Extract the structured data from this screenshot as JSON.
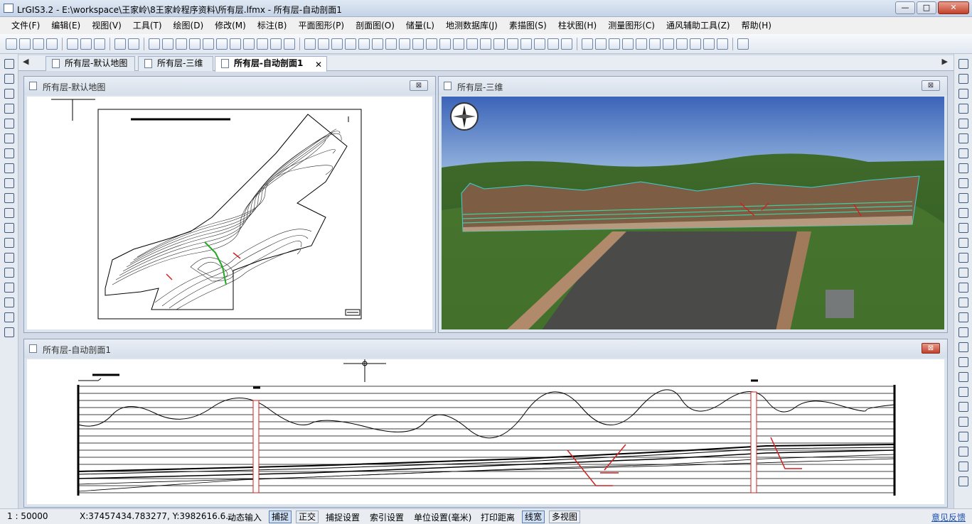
{
  "window": {
    "title": "LrGIS3.2 - E:\\workspace\\王家岭\\8王家岭程序资料\\所有层.lfmx - 所有层-自动剖面1",
    "minimize": "—",
    "maximize": "□",
    "close": "✕"
  },
  "menu": [
    "文件(F)",
    "编辑(E)",
    "视图(V)",
    "工具(T)",
    "绘图(D)",
    "修改(M)",
    "标注(B)",
    "平面图形(P)",
    "剖面图(O)",
    "储量(L)",
    "地测数据库(J)",
    "素描图(S)",
    "柱状图(H)",
    "测量图形(C)",
    "通风辅助工具(Z)",
    "帮助(H)"
  ],
  "tabs": [
    {
      "label": "所有层-默认地图",
      "active": false
    },
    {
      "label": "所有层-三维",
      "active": false
    },
    {
      "label": "所有层-自动剖面1",
      "active": true
    }
  ],
  "tab_close": "✕",
  "tab_nav": {
    "left": "◀",
    "right": "▶"
  },
  "panes": {
    "map": {
      "title": "所有层-默认地图",
      "close": "⊠"
    },
    "threed": {
      "title": "所有层-三维",
      "close": "⊠"
    },
    "profile": {
      "title": "所有层-自动剖面1",
      "close": "⊠"
    }
  },
  "status": {
    "scale": "1 : 50000",
    "coords": "X:37457434.783277, Y:3982616.6...",
    "dynamic_input": "动态输入",
    "snap": "捕捉",
    "ortho": "正交",
    "snap_settings": "捕捉设置",
    "index_settings": "索引设置",
    "unit_settings": "单位设置(毫米)",
    "print_distance": "打印距离",
    "line_width": "线宽",
    "multi_view": "多视图",
    "feedback": "意见反馈"
  },
  "colors": {
    "sky": "#4a72c4",
    "terrain": "#3f6a2a",
    "section": "#8a6a50",
    "drill": "#d02020",
    "accent": "#5b7fb0"
  }
}
